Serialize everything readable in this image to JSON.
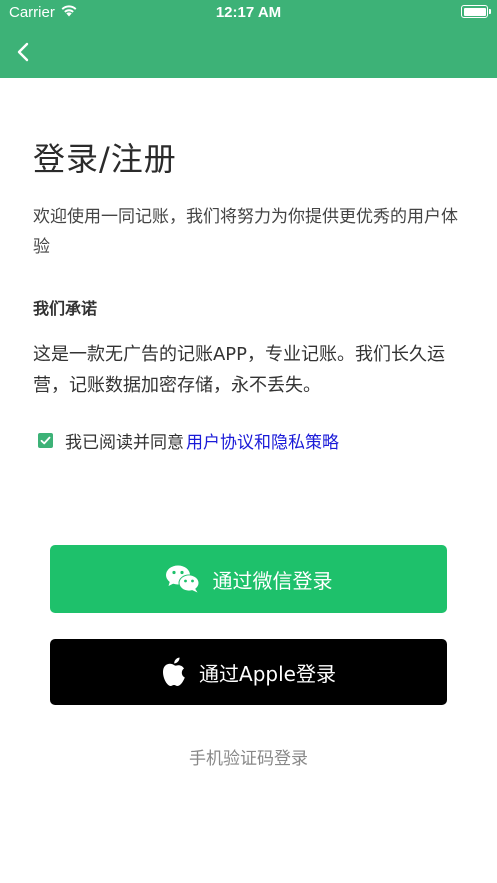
{
  "status_bar": {
    "carrier": "Carrier",
    "time": "12:17 AM"
  },
  "header": {
    "back_icon": "chevron-left-icon",
    "background": "#3db277"
  },
  "main": {
    "title": "登录/注册",
    "welcome": "欢迎使用一同记账，我们将努力为你提供更优秀的用户体验",
    "promise_heading": "我们承诺",
    "promise_text": "这是一款无广告的记账APP，专业记账。我们长久运营，记账数据加密存储，永不丢失。"
  },
  "agreement": {
    "checked": true,
    "prefix": "我已阅读并同意",
    "link": "用户协议和隐私策略"
  },
  "buttons": {
    "wechat_label": "通过微信登录",
    "wechat_color": "#1ec16b",
    "apple_label": "通过Apple登录",
    "apple_color": "#000000"
  },
  "sms_login": "手机验证码登录"
}
